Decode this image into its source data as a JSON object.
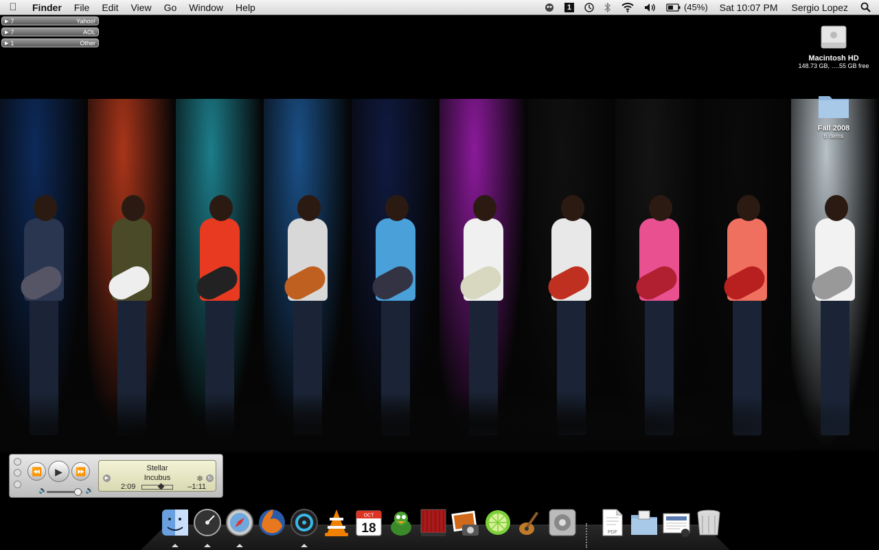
{
  "menubar": {
    "apple_icon": "apple-icon",
    "app_name": "Finder",
    "menus": [
      "File",
      "Edit",
      "View",
      "Go",
      "Window",
      "Help"
    ],
    "status_icons": [
      "adium-duck-icon",
      "spaces-icon",
      "time-machine-icon",
      "bluetooth-icon",
      "wifi-icon",
      "volume-icon",
      "battery-icon"
    ],
    "spaces_number": "1",
    "battery": "(45%)",
    "clock": "Sat 10:07 PM",
    "user": "Sergio Lopez",
    "search_icon": "spotlight-icon"
  },
  "mail_counter": [
    {
      "count": "7",
      "name": "Yahoo!"
    },
    {
      "count": "7",
      "name": "AOL"
    },
    {
      "count": "1",
      "name": "Other"
    }
  ],
  "desktop": {
    "hd": {
      "name": "Macintosh HD",
      "info": "148.73 GB, ….55 GB free"
    },
    "folder": {
      "name": "Fall 2008",
      "info": "6 items"
    }
  },
  "wallpaper_colors": [
    "#0d2a5a",
    "#a8351a",
    "#1c7d8a",
    "#1a4f86",
    "#101a40",
    "#8a1a9a",
    "#101010",
    "#141414",
    "#0a0a0a",
    "#b8c2c8"
  ],
  "player": {
    "song": "Stellar",
    "artist": "Incubus",
    "elapsed": "2:09",
    "remaining": "–1:11",
    "progress": 0.64,
    "volume": 0.85
  },
  "dock": [
    {
      "name": "finder-icon"
    },
    {
      "name": "dashboard-icon"
    },
    {
      "name": "safari-icon"
    },
    {
      "name": "firefox-icon"
    },
    {
      "name": "itunes-icon"
    },
    {
      "name": "vlc-icon"
    },
    {
      "name": "ical-icon",
      "month": "OCT",
      "day": "18"
    },
    {
      "name": "adium-icon"
    },
    {
      "name": "front-row-icon"
    },
    {
      "name": "iphoto-icon"
    },
    {
      "name": "limewire-icon"
    },
    {
      "name": "garageband-icon"
    },
    {
      "name": "system-preferences-icon"
    },
    {
      "name": "pdf-document-icon"
    },
    {
      "name": "applications-folder-icon"
    },
    {
      "name": "downloads-stack-icon"
    },
    {
      "name": "trash-icon"
    }
  ]
}
